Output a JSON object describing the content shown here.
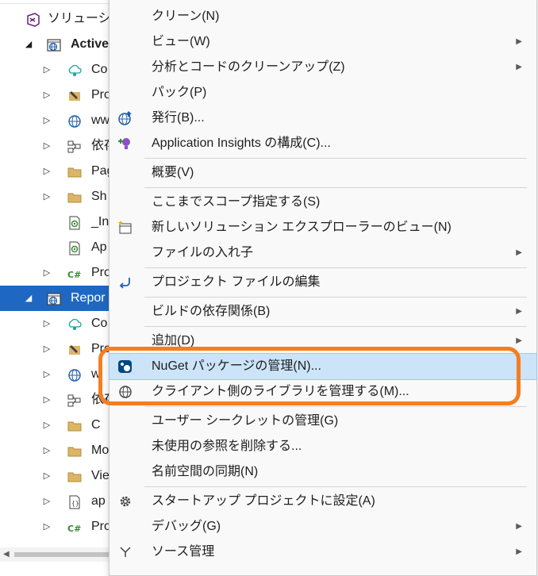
{
  "explorer": {
    "rows": [
      {
        "label": "ソリューショ",
        "expander": "",
        "icon": "vs-solution-icon",
        "bold": false,
        "selected": false
      },
      {
        "label": "Active",
        "expander": "◢",
        "icon": "web-project-icon",
        "bold": true,
        "selected": false
      },
      {
        "label": "Co",
        "expander": "▷",
        "icon": "connected-services-icon",
        "bold": false,
        "selected": false
      },
      {
        "label": "Pro",
        "expander": "▷",
        "icon": "wrench-icon",
        "bold": false,
        "selected": false
      },
      {
        "label": "ww",
        "expander": "▷",
        "icon": "globe-icon",
        "bold": false,
        "selected": false
      },
      {
        "label": "依存",
        "expander": "▷",
        "icon": "dependencies-icon",
        "bold": false,
        "selected": false
      },
      {
        "label": "Pag",
        "expander": "▷",
        "icon": "folder-icon",
        "bold": false,
        "selected": false
      },
      {
        "label": "Sh",
        "expander": "▷",
        "icon": "folder-icon",
        "bold": false,
        "selected": false
      },
      {
        "label": "_In",
        "expander": "",
        "icon": "razor-file-icon",
        "bold": false,
        "selected": false
      },
      {
        "label": "Ap",
        "expander": "",
        "icon": "razor-file-icon",
        "bold": false,
        "selected": false
      },
      {
        "label": "Pro",
        "expander": "▷",
        "icon": "csharp-file-icon",
        "bold": false,
        "selected": false
      },
      {
        "label": "Repor",
        "expander": "◢",
        "icon": "web-project-icon",
        "bold": false,
        "selected": true
      },
      {
        "label": "Co",
        "expander": "▷",
        "icon": "connected-services-icon",
        "bold": false,
        "selected": false
      },
      {
        "label": "Pro",
        "expander": "▷",
        "icon": "wrench-icon",
        "bold": false,
        "selected": false
      },
      {
        "label": "w",
        "expander": "▷",
        "icon": "globe-icon",
        "bold": false,
        "selected": false
      },
      {
        "label": "依存",
        "expander": "▷",
        "icon": "dependencies-icon",
        "bold": false,
        "selected": false
      },
      {
        "label": "C",
        "expander": "▷",
        "icon": "folder-icon",
        "bold": false,
        "selected": false
      },
      {
        "label": "Mo",
        "expander": "▷",
        "icon": "folder-icon",
        "bold": false,
        "selected": false
      },
      {
        "label": "Vie",
        "expander": "▷",
        "icon": "folder-icon",
        "bold": false,
        "selected": false
      },
      {
        "label": "ap",
        "expander": "▷",
        "icon": "json-file-icon",
        "bold": false,
        "selected": false
      },
      {
        "label": "Pro",
        "expander": "▷",
        "icon": "csharp-file-icon",
        "bold": false,
        "selected": false
      }
    ]
  },
  "menu": {
    "items": [
      {
        "type": "item",
        "label": "クリーン(N)",
        "icon": "",
        "submenu": false
      },
      {
        "type": "item",
        "label": "ビュー(W)",
        "icon": "",
        "submenu": true
      },
      {
        "type": "item",
        "label": "分析とコードのクリーンアップ(Z)",
        "icon": "",
        "submenu": true
      },
      {
        "type": "item",
        "label": "パック(P)",
        "icon": "",
        "submenu": false
      },
      {
        "type": "item",
        "label": "発行(B)...",
        "icon": "publish-globe-icon",
        "submenu": false
      },
      {
        "type": "item",
        "label": "Application Insights の構成(C)...",
        "icon": "application-insights-icon",
        "submenu": false
      },
      {
        "type": "sep"
      },
      {
        "type": "item",
        "label": "概要(V)",
        "icon": "",
        "submenu": false
      },
      {
        "type": "sep"
      },
      {
        "type": "item",
        "label": "ここまでスコープ指定する(S)",
        "icon": "",
        "submenu": false
      },
      {
        "type": "item",
        "label": "新しいソリューション エクスプローラーのビュー(N)",
        "icon": "new-explorer-view-icon",
        "submenu": false
      },
      {
        "type": "item",
        "label": "ファイルの入れ子",
        "icon": "",
        "submenu": true
      },
      {
        "type": "sep"
      },
      {
        "type": "item",
        "label": "プロジェクト ファイルの編集",
        "icon": "edit-project-arrow-icon",
        "submenu": false
      },
      {
        "type": "sep"
      },
      {
        "type": "item",
        "label": "ビルドの依存関係(B)",
        "icon": "",
        "submenu": true
      },
      {
        "type": "sep"
      },
      {
        "type": "item",
        "label": "追加(D)",
        "icon": "",
        "submenu": true
      },
      {
        "type": "item",
        "label": "NuGet パッケージの管理(N)...",
        "icon": "nuget-icon",
        "submenu": false,
        "hover": true
      },
      {
        "type": "item",
        "label": "クライアント側のライブラリを管理する(M)...",
        "icon": "client-library-globe-icon",
        "submenu": false
      },
      {
        "type": "sep"
      },
      {
        "type": "item",
        "label": "ユーザー シークレットの管理(G)",
        "icon": "",
        "submenu": false
      },
      {
        "type": "item",
        "label": "未使用の参照を削除する...",
        "icon": "",
        "submenu": false
      },
      {
        "type": "item",
        "label": "名前空間の同期(N)",
        "icon": "",
        "submenu": false
      },
      {
        "type": "sep"
      },
      {
        "type": "item",
        "label": "スタートアップ プロジェクトに設定(A)",
        "icon": "gear-icon",
        "submenu": false
      },
      {
        "type": "item",
        "label": "デバッグ(G)",
        "icon": "",
        "submenu": true
      },
      {
        "type": "item",
        "label": "ソース管理",
        "icon": "source-control-icon",
        "submenu": true
      }
    ]
  },
  "colors": {
    "selection": "#1e68c4",
    "hover": "#cce4f7",
    "highlight": "#f47e20",
    "menu_bg": "#f9f9f9"
  }
}
